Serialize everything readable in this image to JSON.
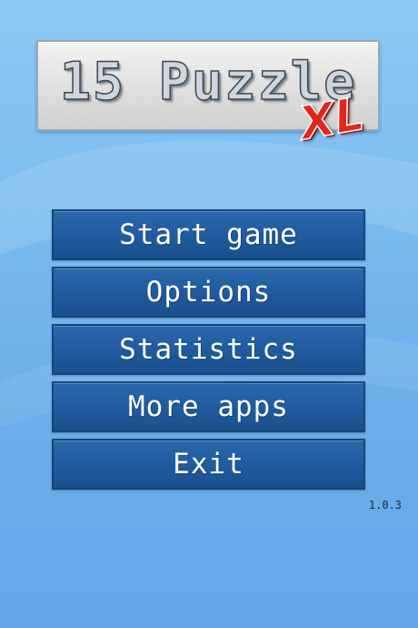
{
  "logo": {
    "title": "15 Puzzle",
    "badge": "XL"
  },
  "menu": {
    "items": [
      {
        "label": "Start game"
      },
      {
        "label": "Options"
      },
      {
        "label": "Statistics"
      },
      {
        "label": "More apps"
      },
      {
        "label": "Exit"
      }
    ]
  },
  "version": "1.0.3",
  "colors": {
    "background": "#6aaeea",
    "button": "#1f5a9d",
    "button_border": "#164678",
    "badge": "#e2261b",
    "logo_panel": "#e2e3e2"
  }
}
